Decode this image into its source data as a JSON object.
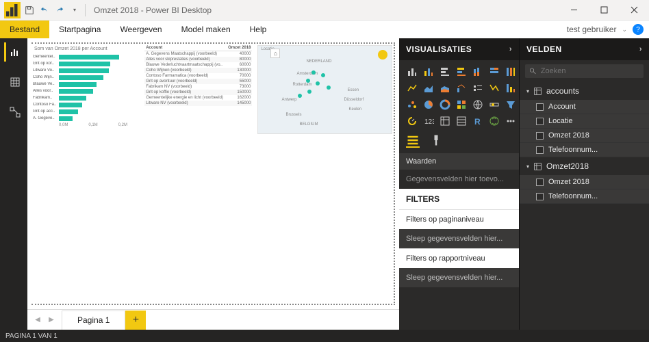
{
  "title": "Omzet 2018 - Power BI Desktop",
  "menu": {
    "file": "Bestand",
    "start": "Startpagina",
    "view": "Weergeven",
    "model": "Model maken",
    "help": "Help"
  },
  "user": "test gebruiker",
  "visualisations_label": "VISUALISATIES",
  "fields_label": "VELDEN",
  "values_label": "Waarden",
  "values_drop": "Gegevensvelden hier toevo...",
  "filters_label": "FILTERS",
  "filter_page": "Filters op paginaniveau",
  "filter_report": "Filters op rapportniveau",
  "filter_drop": "Sleep gegevensvelden hier...",
  "search_placeholder": "Zoeken",
  "page_tab": "Pagina 1",
  "status": "PAGINA 1 VAN 1",
  "tables": [
    {
      "name": "accounts",
      "fields": [
        "Account",
        "Locatie",
        "Omzet 2018",
        "Telefoonnum..."
      ]
    },
    {
      "name": "Omzet2018",
      "fields": [
        "Omzet 2018",
        "Telefoonnum..."
      ]
    }
  ],
  "chart_data": {
    "type": "bar",
    "title": "Som van Omzet 2018 per Account",
    "xlim": [
      0,
      200000
    ],
    "xticks": [
      "0,0M",
      "0,1M",
      "0,2M"
    ],
    "categories": [
      "Gemeentel..",
      "Grit op kof..",
      "Litware Vo..",
      "Coho Wijn..",
      "Blauwe Ve..",
      "Alles voor..",
      "Fabrikam..",
      "Contoso Fa..",
      "Grit op acc..",
      "A. Gegeve.."
    ],
    "values": [
      175000,
      150000,
      145000,
      130000,
      110000,
      100000,
      80000,
      68000,
      55000,
      40000
    ]
  },
  "table_viz": {
    "headers": [
      "Account",
      "Omzet 2018"
    ],
    "rows": [
      [
        "A. Gegevens Maatschappij (voorbeeld)",
        "40000"
      ],
      [
        "Alles voor skiprestaties (voorbeeld)",
        "80000"
      ],
      [
        "Blauwe Vederluchtvaartmaatschappij (vo..",
        "60000"
      ],
      [
        "Coho Wijnen (voorbeeld)",
        "130000"
      ],
      [
        "Contoso Farmamatica (voorbeeld)",
        "70000"
      ],
      [
        "Grit op avontuur (voorbeeld)",
        "55000"
      ],
      [
        "Fabrikam NV (voorbeeld)",
        "73000"
      ],
      [
        "Grit op koffie (voorbeeld)",
        "150000"
      ],
      [
        "Gemeentelijke energie en licht (voorbeeld)",
        "162000"
      ],
      [
        "Litware NV (voorbeeld)",
        "145000"
      ]
    ]
  },
  "map_viz": {
    "title": "Locatie",
    "labels": [
      "NEDERLAND",
      "Amsterdam",
      "Rotterdam",
      "Antwerp",
      "Brussels",
      "Essen",
      "Düsseldorf",
      "Keulen",
      "BELGIUM"
    ]
  }
}
